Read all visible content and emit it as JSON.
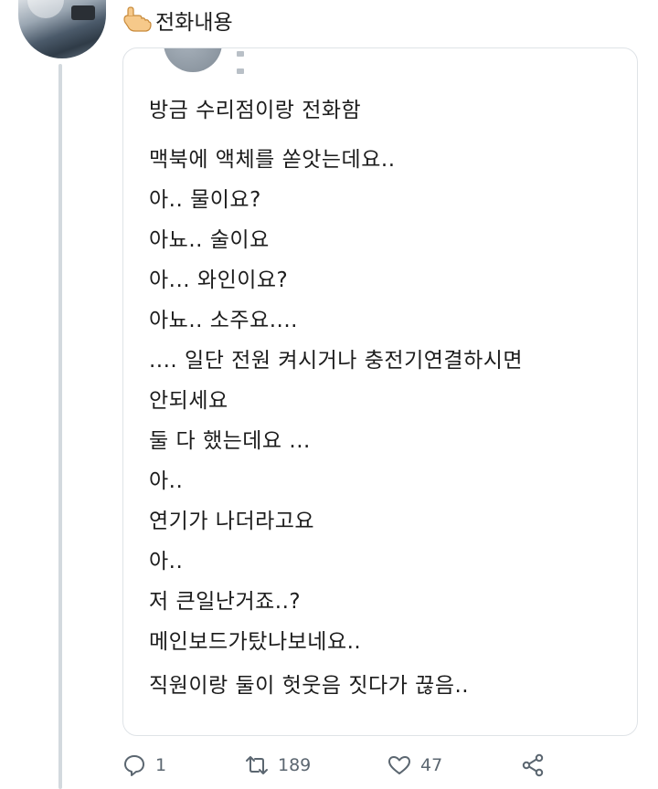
{
  "header": {
    "pointer_icon": "pointing-hand-icon",
    "title": "전화내용"
  },
  "tweet": {
    "lines": [
      "방금 수리점이랑 전화함",
      "맥북에 액체를 쏟앗는데요..",
      "아.. 물이요?",
      "아뇨.. 술이요",
      "아... 와인이요?",
      "아뇨.. 소주요....",
      ".... 일단 전원 켜시거나 충전기연결하시면",
      "안되세요",
      "둘 다 했는데요 ...",
      "아..",
      "연기가 나더라고요",
      "아..",
      "저 큰일난거죠..?",
      "메인보드가탔나보네요..",
      "직원이랑 둘이 헛웃음 짓다가 끊음.."
    ]
  },
  "actions": {
    "reply_count": "1",
    "retweet_count": "189",
    "like_count": "47",
    "icons": [
      "reply-icon",
      "retweet-icon",
      "like-icon",
      "share-icon"
    ]
  },
  "colors": {
    "text": "#1c1c1c",
    "muted": "#5b6670",
    "border": "#dfe3e7",
    "thread_line": "#d3d9de"
  }
}
